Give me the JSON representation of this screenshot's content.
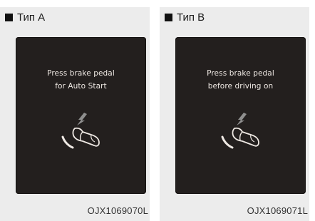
{
  "panels": [
    {
      "title": "Тип A",
      "message_lines": [
        "Press brake pedal",
        "for Auto Start"
      ],
      "code": "OJX1069070L"
    },
    {
      "title": "Тип B",
      "message_lines": [
        "Press brake pedal",
        "before driving on"
      ],
      "code": "OJX1069071L"
    }
  ],
  "icons": {
    "panel_marker": "black-square-icon",
    "screen_symbol": "foot-on-brake-pedal-icon"
  },
  "colors": {
    "panel_background": "#ececec",
    "screen_background": "#231f1e",
    "screen_text": "#efe9e4"
  }
}
